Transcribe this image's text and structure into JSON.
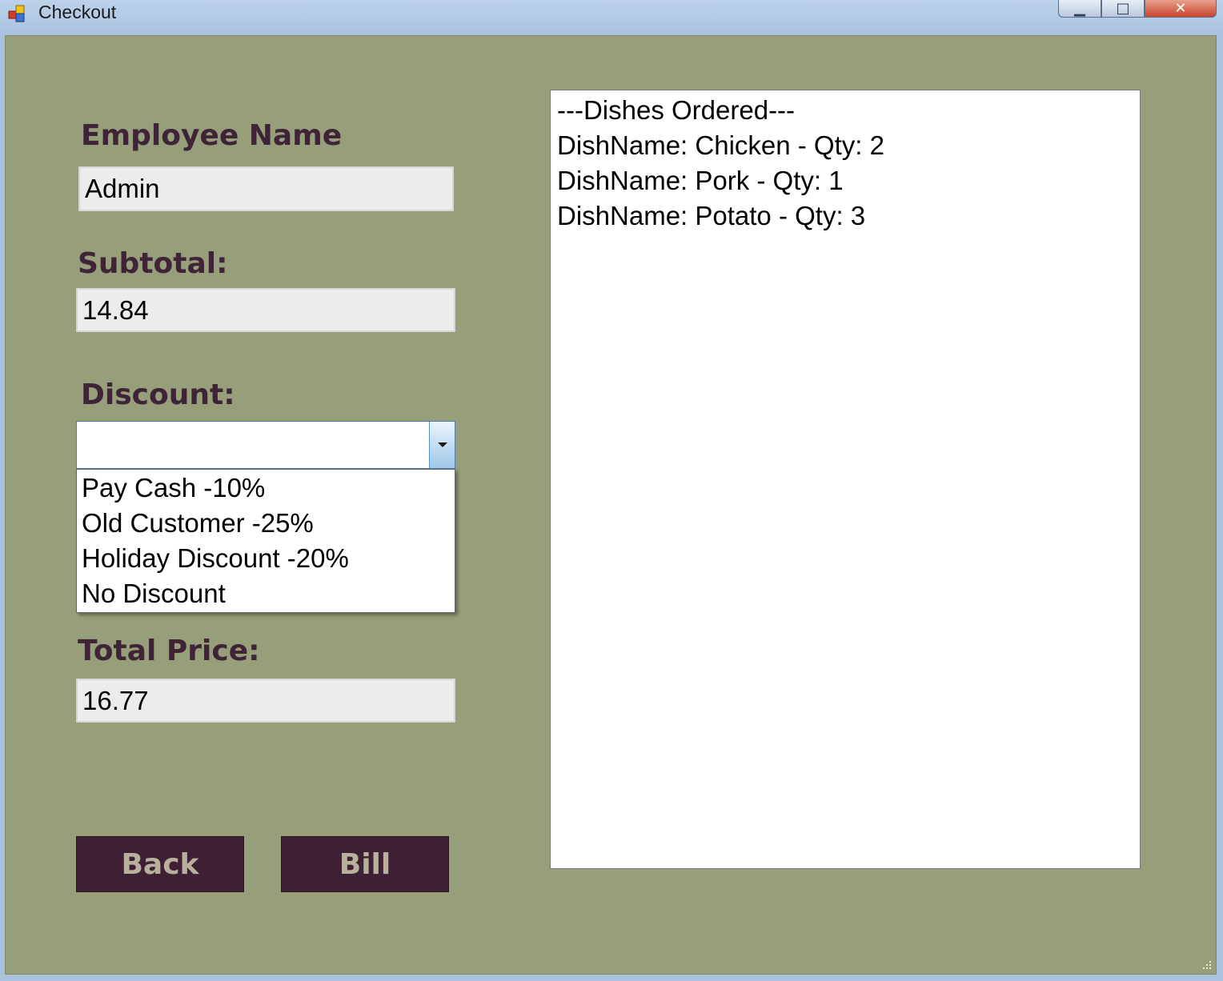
{
  "window": {
    "title": "Checkout",
    "controls": {
      "minimize_glyph": "▁",
      "maximize_glyph": "□",
      "close_glyph": "✕"
    }
  },
  "form": {
    "employee_label": "Employee Name",
    "employee_value": "Admin",
    "subtotal_label": "Subtotal:",
    "subtotal_value": "14.84",
    "discount_label": "Discount:",
    "discount_value": "",
    "discount_options": [
      "Pay Cash -10%",
      "Old Customer -25%",
      "Holiday Discount -20%",
      "No Discount"
    ],
    "total_label": "Total Price:",
    "total_value": "16.77"
  },
  "buttons": {
    "back_label": "Back",
    "bill_label": "Bill"
  },
  "order_list": {
    "lines": [
      "---Dishes Ordered---",
      "DishName: Chicken - Qty: 2",
      "DishName: Pork - Qty: 1",
      "DishName: Potato - Qty: 3"
    ]
  },
  "colors": {
    "form_background": "#969f7a",
    "label_text": "#3f2336",
    "button_background": "#3e1f33",
    "button_text": "#b8b09c"
  },
  "icons": {
    "app": "windows-form-icon",
    "dropdown": "chevron-down-icon",
    "resize": "resize-grip-icon"
  }
}
